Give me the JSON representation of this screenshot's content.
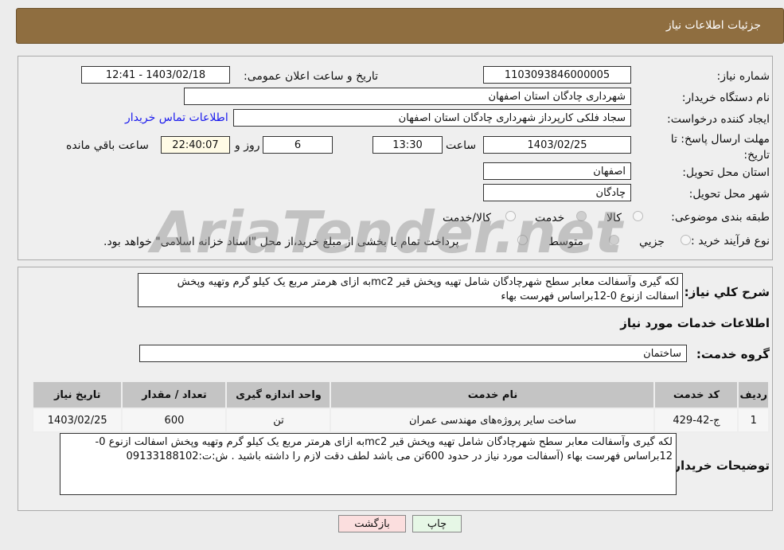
{
  "header": {
    "title": "جزئیات اطلاعات نیاز"
  },
  "form": {
    "need_number_label": "شماره نیاز:",
    "need_number": "1103093846000005",
    "announce_label": "تاریخ و ساعت اعلان عمومی:",
    "announce_value": "1403/02/18 - 12:41",
    "buyer_label": "نام دستگاه خریدار:",
    "buyer": "شهرداری چادگان استان اصفهان",
    "creator_label": "ایجاد کننده درخواست:",
    "creator": "سجاد فلکی کارپرداز شهرداری چادگان استان اصفهان",
    "contact_link": "اطلاعات تماس خریدار",
    "deadline_label": "مهلت ارسال پاسخ: تا تاریخ:",
    "deadline_date": "1403/02/25",
    "time_label": "ساعت",
    "deadline_time": "13:30",
    "days": "6",
    "days_label": "روز و",
    "remaining": "22:40:07",
    "remaining_label": "ساعت باقي مانده",
    "province_label": "استان محل تحویل:",
    "province": "اصفهان",
    "city_label": "شهر محل تحویل:",
    "city": "چادگان",
    "category_label": "طبقه بندی موضوعی:",
    "category_options": [
      "کالا",
      "خدمت",
      "کالا/خدمت"
    ],
    "category_selected": "خدمت",
    "process_label": "نوع فرآیند خرید :",
    "process_options": [
      "جزیي",
      "متوسط"
    ],
    "process_selected": "متوسط",
    "process_note": "پرداخت تمام یا بخشی از مبلغ خرید،از محل \"اسناد خزانه اسلامی\" خواهد بود."
  },
  "summary": {
    "label": "شرح کلي نیاز:",
    "text": "لکه گیری وآسفالت معابر سطح شهرچادگان شامل تهیه وپخش قیر mc2به ازای هرمتر مربع یک کیلو گرم وتهیه وپخش اسفالت ازنوع 0-12براساس فهرست بهاء"
  },
  "services": {
    "title": "اطلاعات خدمات مورد نیاز",
    "group_label": "گروه خدمت:",
    "group": "ساختمان",
    "columns": [
      "ردیف",
      "کد خدمت",
      "نام خدمت",
      "واحد اندازه گیری",
      "تعداد / مقدار",
      "تاریخ نیاز"
    ],
    "rows": [
      [
        "1",
        "ج-42-429",
        "ساخت سایر پروژه‌های مهندسی عمران",
        "تن",
        "600",
        "1403/02/25"
      ]
    ]
  },
  "buyer_notes": {
    "label": "توضیحات خریدار:",
    "text": "لکه گیری وآسفالت معابر سطح شهرچادگان شامل تهیه وپخش قیر mc2به ازای هرمتر مربع یک کیلو گرم وتهیه وپخش اسفالت ازنوع 0-12براساس فهرست بهاء (آسفالت مورد نیاز در حدود 600تن می باشد لطف دقت لازم را داشته باشید . ش:ت:09133188102"
  },
  "buttons": {
    "print": "چاپ",
    "back": "بازگشت"
  },
  "watermark": "AriaTender.net"
}
